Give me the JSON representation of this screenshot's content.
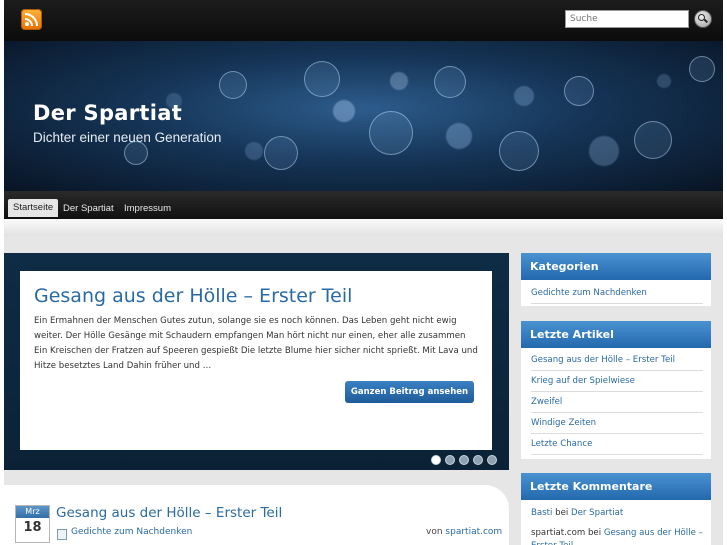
{
  "search": {
    "placeholder": "Suche"
  },
  "site": {
    "title": "Der Spartiat",
    "description": "Dichter einer neuen Generation"
  },
  "nav": {
    "items": [
      "Startseite",
      "Der Spartiat",
      "Impressum"
    ]
  },
  "featured": {
    "title": "Gesang aus der Hölle – Erster Teil",
    "excerpt": "Ein Ermahnen der Menschen Gutes zutun, solange sie es noch können. Das Leben geht nicht ewig weiter. Der Hölle Gesänge mit Schaudern empfangen Man hört nicht nur einen, eher alle zusammen Ein Kreischen der Fratzen auf Speeren gespießt Die letzte Blume hier sicher nicht sprießt. Mit Lava und Hitze besetztes Land Dahin früher und …",
    "button_label": "Ganzen Beitrag ansehen",
    "slide_count": 5,
    "active_slide": 1
  },
  "post": {
    "month": "Mrz",
    "day": "18",
    "title": "Gesang aus der Hölle – Erster Teil",
    "category": "Gedichte zum Nachdenken",
    "author_prefix": "von",
    "author": "spartiat.com"
  },
  "sidebar": {
    "categories": {
      "title": "Kategorien",
      "items": [
        "Gedichte zum Nachdenken"
      ]
    },
    "recent_posts": {
      "title": "Letzte Artikel",
      "items": [
        "Gesang aus der Hölle – Erster Teil",
        "Krieg auf der Spielwiese",
        "Zweifel",
        "Windige Zeiten",
        "Letzte Chance"
      ]
    },
    "recent_comments": {
      "title": "Letzte Kommentare",
      "connector": "bei",
      "items": [
        {
          "author": "Basti",
          "post": "Der Spartiat"
        },
        {
          "author": "spartiat.com",
          "post": "Gesang aus der Hölle – Erster Teil"
        }
      ]
    }
  },
  "colors": {
    "accent": "#2a6aa3",
    "widget_header": "#2f76b8",
    "slider_bg": "#0d263d"
  }
}
